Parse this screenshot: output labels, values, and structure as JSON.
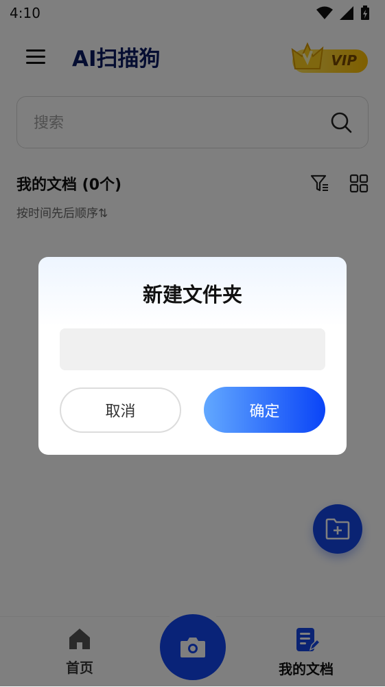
{
  "status_bar": {
    "time": "4:10"
  },
  "app": {
    "title": "AI扫描狗",
    "vip_label": "VIP"
  },
  "search": {
    "placeholder": "搜索"
  },
  "documents": {
    "title": "我的文档 (0个)",
    "sort_label": "按时间先后顺序⇅"
  },
  "bottom_nav": {
    "home_label": "首页",
    "docs_label": "我的文档"
  },
  "dialog": {
    "title": "新建文件夹",
    "input_value": "",
    "cancel_label": "取消",
    "confirm_label": "确定"
  },
  "colors": {
    "primary": "#1446E6",
    "title_navy": "#0B1B63",
    "vip_gold": "#FFC400",
    "overlay": "rgba(0,0,0,0.5)"
  }
}
